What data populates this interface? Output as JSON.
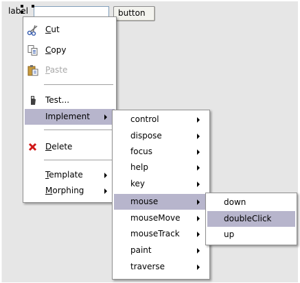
{
  "form": {
    "label_text": "label",
    "button_text": "button"
  },
  "context_menu": {
    "items": [
      {
        "label": "Cut",
        "mnemonic": "C",
        "rest": "ut",
        "icon": "scissors-icon"
      },
      {
        "label": "Copy",
        "mnemonic": "C",
        "rest": "opy",
        "icon": "copy-icon"
      },
      {
        "label": "Paste",
        "mnemonic": "P",
        "rest": "aste",
        "icon": "paste-icon",
        "disabled": true
      },
      {
        "label": "Test...",
        "icon": "test-icon"
      },
      {
        "label": "Implement",
        "submenu": true
      },
      {
        "label": "Delete",
        "mnemonic": "D",
        "rest": "elete",
        "icon": "delete-icon"
      },
      {
        "label": "Template",
        "mnemonic": "T",
        "rest": "emplate",
        "submenu": true
      },
      {
        "label": "Morphing",
        "mnemonic": "M",
        "rest": "orphing",
        "submenu": true
      }
    ]
  },
  "implement_menu": {
    "items": [
      "control",
      "dispose",
      "focus",
      "help",
      "key",
      "mouse",
      "mouseMove",
      "mouseTrack",
      "paint",
      "traverse"
    ],
    "selected": "mouse"
  },
  "mouse_menu": {
    "items": [
      "down",
      "doubleClick",
      "up"
    ],
    "selected": "doubleClick"
  },
  "colors": {
    "highlight": "#b7b5cc",
    "canvas": "#e6e6e6"
  }
}
